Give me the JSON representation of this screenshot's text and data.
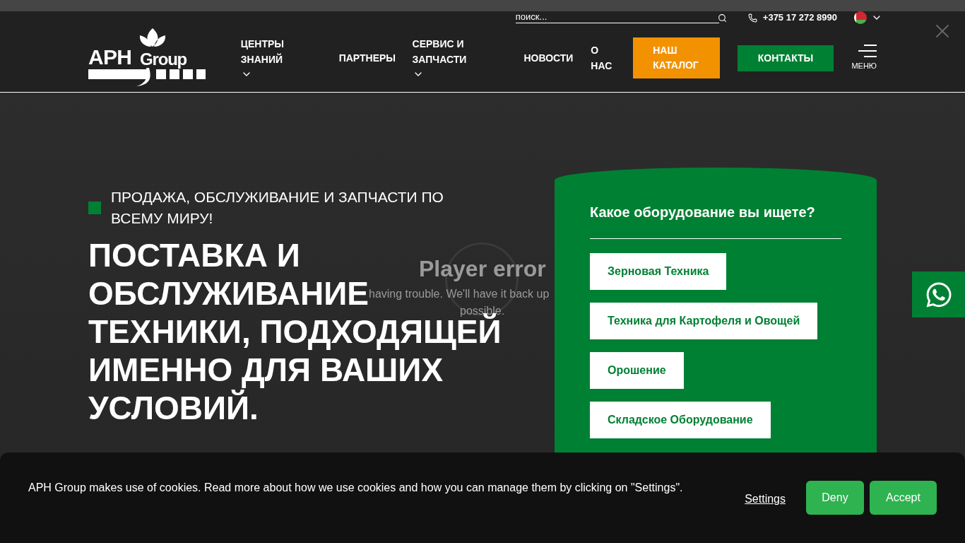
{
  "header": {
    "logo": {
      "main": "APH",
      "sub": "Group"
    },
    "search": {
      "placeholder": "поиск..."
    },
    "phone": "+375 17 272 8990",
    "nav": [
      {
        "label": "ЦЕНТРЫ ЗНАНИЙ",
        "dropdown": true
      },
      {
        "label": "ПАРТНЕРЫ",
        "dropdown": false
      },
      {
        "label": "СЕРВИС И ЗАПЧАСТИ",
        "dropdown": true
      },
      {
        "label": "НОВОСТИ",
        "dropdown": false
      },
      {
        "label": "О НАС",
        "dropdown": false
      }
    ],
    "catalog_button": "НАШ КАТАЛОГ",
    "contacts_button": "КОНТАКТЫ",
    "menu_label": "МЕНЮ"
  },
  "hero": {
    "tagline": "ПРОДАЖА, ОБСЛУЖИВАНИЕ И ЗАПЧАСТИ ПО ВСЕМУ МИРУ!",
    "heading_lines": [
      "ПОСТАВКА И",
      "ОБСЛУЖИВАНИЕ",
      "ТЕХНИКИ, ПОДХОДЯЩЕЙ",
      "ИМЕННО ДЛЯ ВАШИХ",
      "УСЛОВИЙ."
    ]
  },
  "player": {
    "title": "Player error",
    "message": "having trouble. We'll have it back up",
    "message_end": "possible."
  },
  "equipment_card": {
    "title": "Какое оборудование вы ищете?",
    "options": [
      "Зерновая Техника",
      "Техника для Картофеля и Овощей",
      "Орошение",
      "Складское Оборудование"
    ]
  },
  "cookie_banner": {
    "text": "APH Group makes use of cookies. Read more about how we use cookies and how you can manage them by clicking on \"Settings\".",
    "settings": "Settings",
    "deny": "Deny",
    "accept": "Accept"
  }
}
